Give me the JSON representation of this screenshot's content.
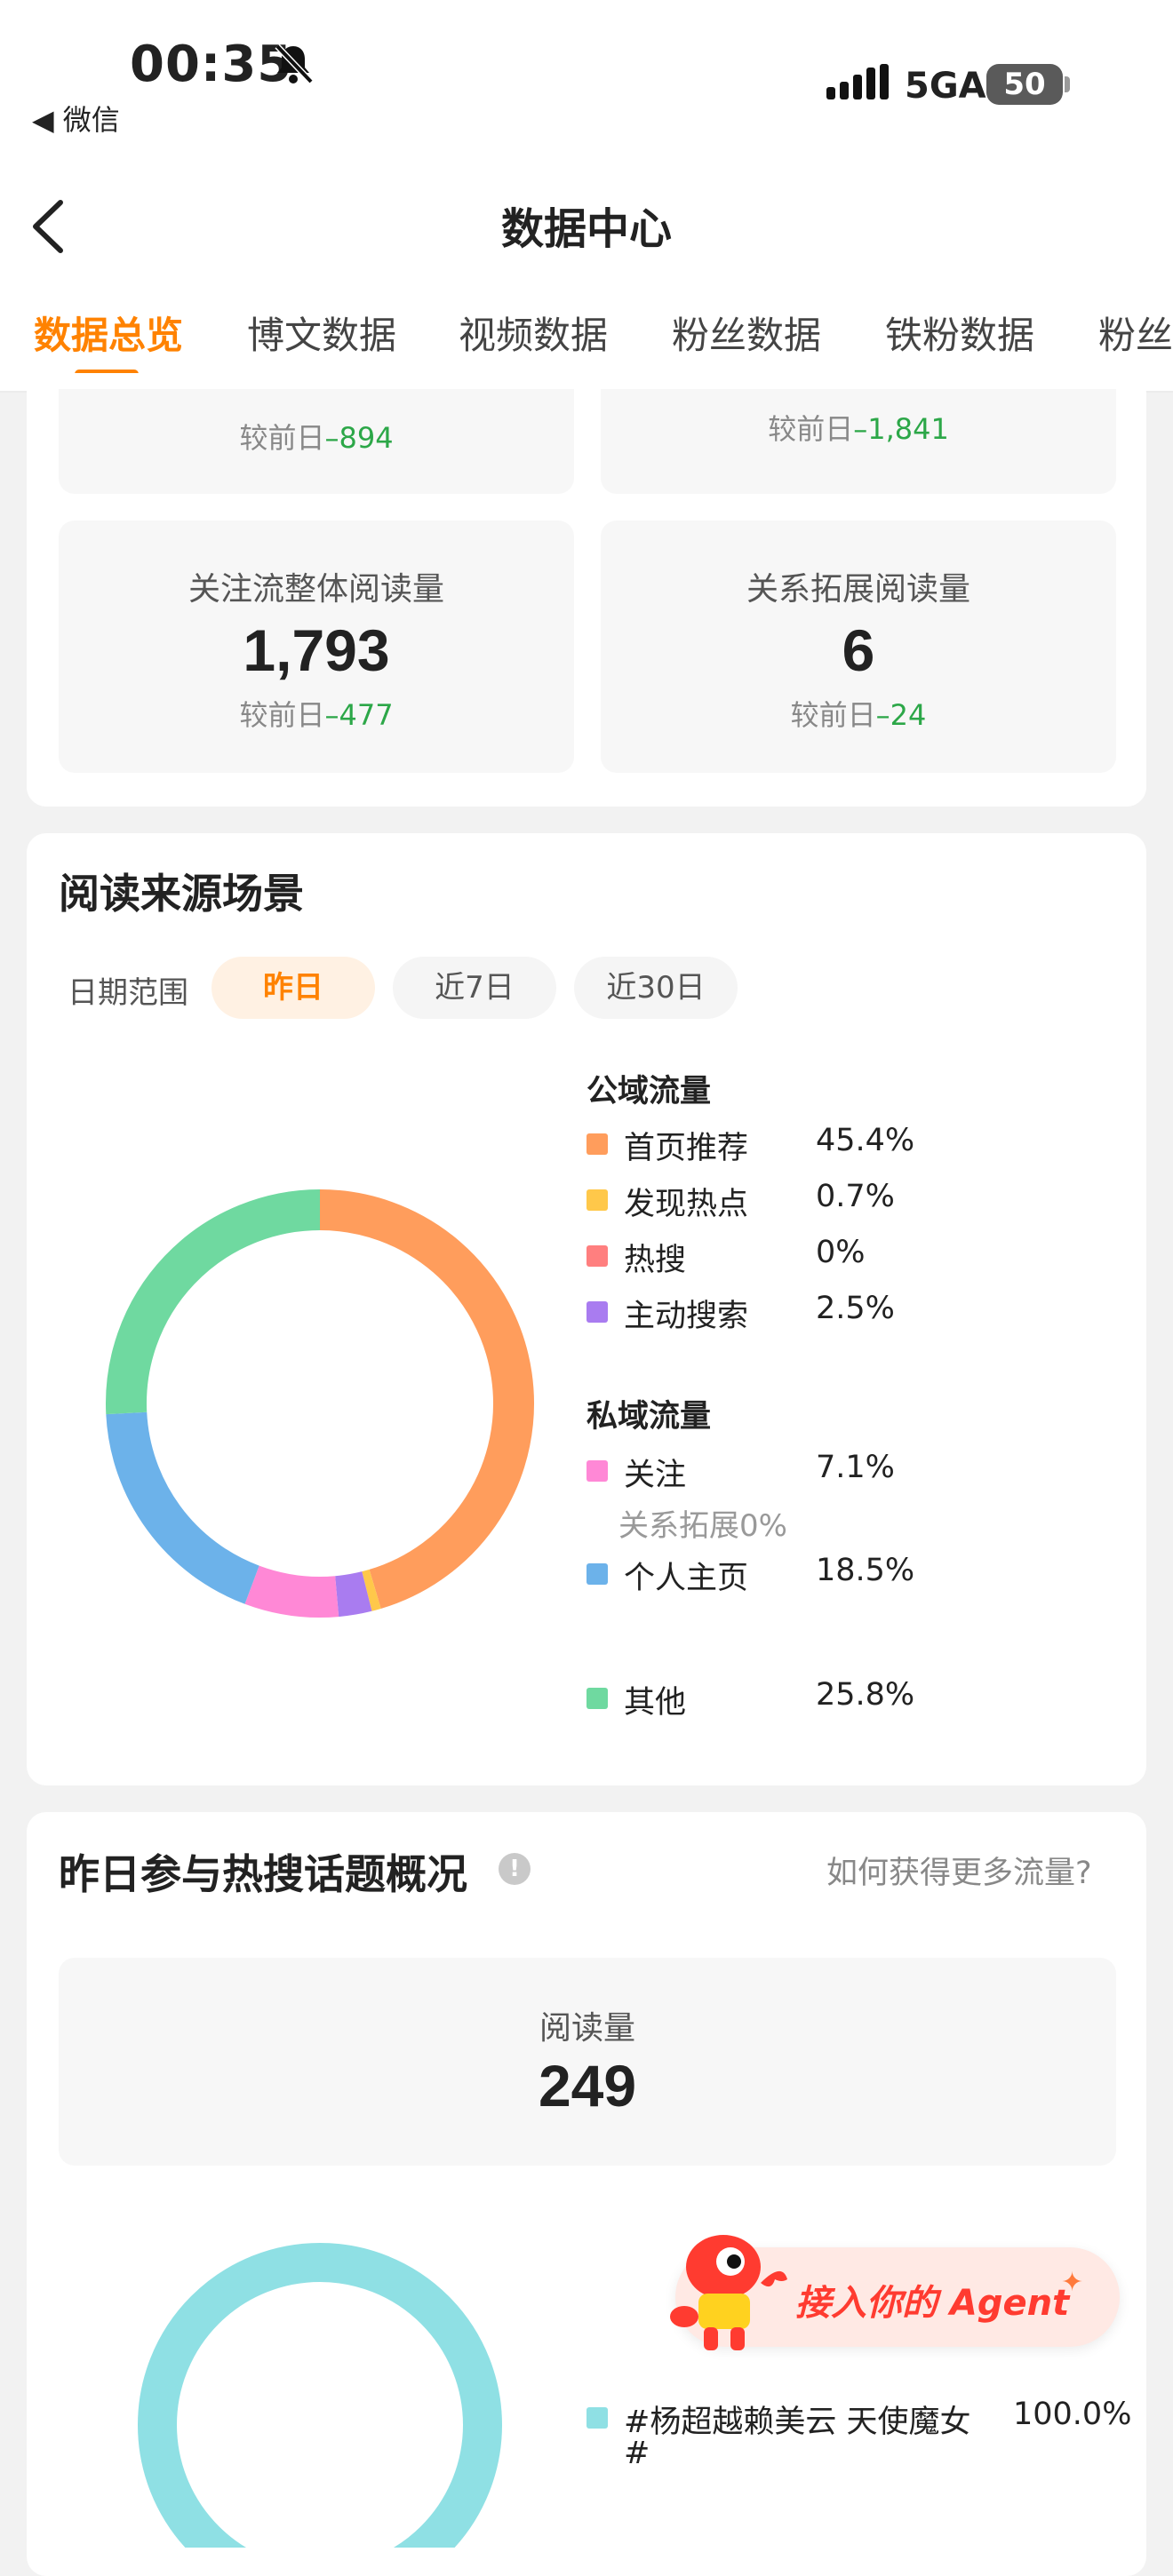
{
  "status_bar": {
    "time": "00:35",
    "back_app": "◀ 微信",
    "network": "5GA",
    "battery": "50"
  },
  "nav": {
    "title": "数据中心",
    "tabs": [
      "数据总览",
      "博文数据",
      "视频数据",
      "粉丝数据",
      "铁粉数据",
      "粉丝"
    ],
    "active_tab": 0
  },
  "overview": {
    "top_partial": [
      {
        "compare_prefix": "较前日",
        "compare_value": "–894"
      },
      {
        "compare_prefix": "较前日",
        "compare_value": "–1,841"
      }
    ],
    "stats": [
      {
        "label": "关注流整体阅读量",
        "value": "1,793",
        "compare_prefix": "较前日",
        "compare_value": "–477"
      },
      {
        "label": "关系拓展阅读量",
        "value": "6",
        "compare_prefix": "较前日",
        "compare_value": "–24"
      }
    ]
  },
  "read_source": {
    "title": "阅读来源场景",
    "date_range_label": "日期范围",
    "ranges": [
      "昨日",
      "近7日",
      "近30日"
    ],
    "active_range": 0,
    "public_group": "公域流量",
    "private_group": "私域流量",
    "relation_note": "关系拓展0%",
    "legend": [
      {
        "name": "首页推荐",
        "pct": "45.4%",
        "color": "#ff9d5c"
      },
      {
        "name": "发现热点",
        "pct": "0.7%",
        "color": "#ffc84a"
      },
      {
        "name": "热搜",
        "pct": "0%",
        "color": "#ff7f7f"
      },
      {
        "name": "主动搜索",
        "pct": "2.5%",
        "color": "#a97cf0"
      },
      {
        "name": "关注",
        "pct": "7.1%",
        "color": "#ff88d6"
      },
      {
        "name": "个人主页",
        "pct": "18.5%",
        "color": "#6cb2ea"
      },
      {
        "name": "其他",
        "pct": "25.8%",
        "color": "#6fd9a0"
      }
    ]
  },
  "chart_data": {
    "type": "pie",
    "categories": [
      "首页推荐",
      "发现热点",
      "热搜",
      "主动搜索",
      "关注",
      "个人主页",
      "其他"
    ],
    "values": [
      45.4,
      0.7,
      0,
      2.5,
      7.1,
      18.5,
      25.8
    ],
    "colors": [
      "#ff9d5c",
      "#ffc84a",
      "#ff7f7f",
      "#a97cf0",
      "#ff88d6",
      "#6cb2ea",
      "#6fd9a0"
    ]
  },
  "hot_topics": {
    "title": "昨日参与热搜话题概况",
    "info_icon": "!",
    "help_link": "如何获得更多流量?",
    "read_label": "阅读量",
    "read_value": "249",
    "topic_line1": "#杨超越赖美云 天使魔女",
    "topic_line2": "#",
    "topic_pct": "100.0%",
    "topic_color": "#8fe0e4"
  },
  "agent_badge": {
    "text": "接入你的 Agent"
  }
}
